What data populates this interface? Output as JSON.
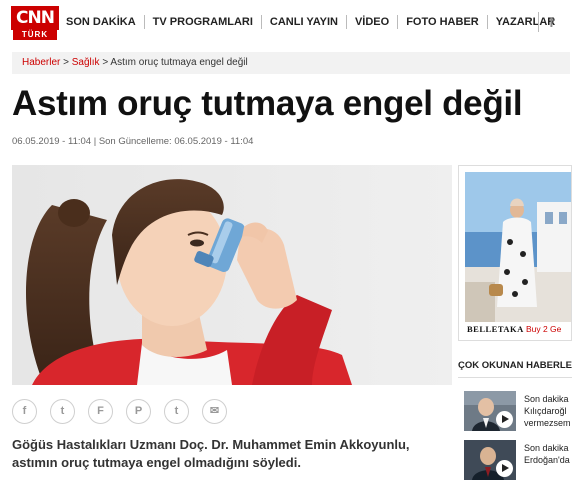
{
  "logo": {
    "primary": "CNN",
    "secondary": "TÜRK"
  },
  "nav": {
    "items": [
      "SON DAKİKA",
      "TV PROGRAMLARI",
      "CANLI YAYIN",
      "VİDEO",
      "FOTO HABER",
      "YAZARLAR"
    ],
    "facebook": "f"
  },
  "breadcrumb": {
    "home": "Haberler",
    "sep": " > ",
    "category": "Sağlık",
    "current": "Astım oruç tutmaya engel değil"
  },
  "article": {
    "title": "Astım oruç tutmaya engel değil",
    "published": "06.05.2019 - 11:04",
    "updated_label": "Son Güncelleme:",
    "updated": "06.05.2019 - 11:04",
    "summary": "Göğüs Hastalıkları Uzmanı Doç. Dr. Muhammet Emin Akkoyunlu, astımın oruç tutmaya engel olmadığını söyledi."
  },
  "share": {
    "icons": [
      {
        "name": "facebook-share-icon",
        "glyph": "f"
      },
      {
        "name": "twitter-share-icon",
        "glyph": "t"
      },
      {
        "name": "flipboard-share-icon",
        "glyph": "F"
      },
      {
        "name": "pinterest-share-icon",
        "glyph": "P"
      },
      {
        "name": "tumblr-share-icon",
        "glyph": "t"
      },
      {
        "name": "email-share-icon",
        "glyph": "✉"
      }
    ]
  },
  "ad": {
    "brand": "BELLETAKA",
    "promo": "Buy 2 Ge"
  },
  "popular": {
    "title": "ÇOK OKUNAN HABERLER",
    "items": [
      {
        "line1": "Son dakika",
        "line2": "Kılıçdaroğl",
        "line3": "vermezsem"
      },
      {
        "line1": "Son dakika",
        "line2": "Erdoğan'da",
        "line3": ""
      }
    ]
  },
  "colors": {
    "accent": "#cc0000",
    "breadcrumb_bg": "#f2f2f2"
  }
}
